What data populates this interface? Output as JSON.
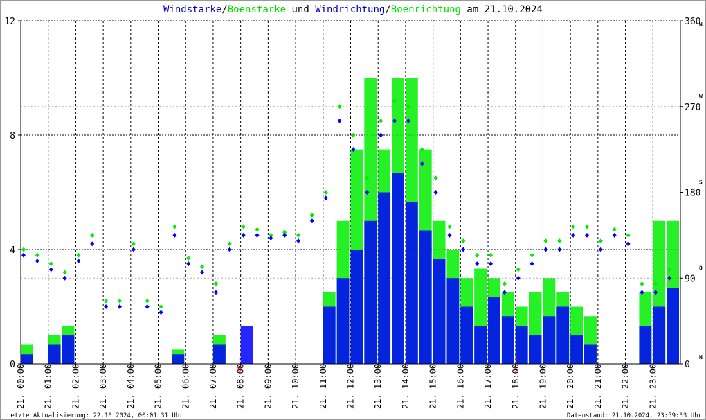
{
  "chart_data": {
    "type": "scatter",
    "title_parts": [
      {
        "text": "Windstarke",
        "color": "#0000c0"
      },
      {
        "text": "/",
        "color": "#000000"
      },
      {
        "text": "Boenstarke",
        "color": "#00e000"
      },
      {
        "text": " und ",
        "color": "#000000"
      },
      {
        "text": "Windrichtung",
        "color": "#0000c0"
      },
      {
        "text": "/",
        "color": "#000000"
      },
      {
        "text": "Boenrichtung",
        "color": "#00e000"
      },
      {
        "text": " am 21.10.2024",
        "color": "#000000"
      }
    ],
    "left_axis": {
      "ylim": [
        0,
        12
      ],
      "ticks": [
        "0",
        "4",
        "8",
        "12"
      ]
    },
    "right_axis": {
      "ylim": [
        0,
        360
      ],
      "ticks": [
        "0",
        "90",
        "180",
        "270",
        "360"
      ],
      "compass": [
        "N",
        "O",
        "S",
        "W",
        "N"
      ]
    },
    "x_ticks": [
      "21. 00:00",
      "21. 01:00",
      "21. 02:00",
      "21. 03:00",
      "21. 04:00",
      "21. 05:00",
      "21. 06:00",
      "21. 07:00",
      "21. 08:00",
      "21. 09:00",
      "21. 10:00",
      "21. 11:00",
      "21. 12:00",
      "21. 13:00",
      "21. 14:00",
      "21. 15:00",
      "21. 16:00",
      "21. 17:00",
      "21. 18:00",
      "21. 19:00",
      "21. 20:00",
      "21. 21:00",
      "21. 22:00",
      "21. 23:00"
    ],
    "grid": true,
    "x_hours": [
      0,
      0.5,
      1,
      1.5,
      2,
      2.5,
      3,
      3.5,
      4,
      4.5,
      5,
      5.5,
      6,
      6.5,
      7,
      7.5,
      8,
      8.5,
      9,
      9.5,
      10,
      10.5,
      11,
      11.5,
      12,
      12.5,
      13,
      13.5,
      14,
      14.5,
      15,
      15.5,
      16,
      16.5,
      17,
      17.5,
      18,
      18.5,
      19,
      19.5,
      20,
      20.5,
      21,
      21.5,
      22,
      22.5,
      23,
      23.5
    ],
    "series": [
      {
        "name": "Windstarke",
        "color": "#0000ff",
        "axis": "left",
        "values": [
          3.8,
          3.6,
          3.3,
          3.0,
          3.6,
          4.2,
          2.0,
          2.0,
          4.0,
          2.0,
          1.8,
          4.5,
          3.5,
          3.2,
          2.5,
          4.0,
          4.5,
          4.5,
          4.4,
          4.5,
          4.3,
          5.0,
          5.8,
          8.5,
          7.5,
          6.0,
          8.0,
          8.5,
          8.5,
          7.0,
          6.0,
          4.5,
          4.0,
          3.5,
          3.5,
          2.5,
          3.0,
          3.5,
          4.0,
          4.0,
          4.5,
          4.5,
          4.0,
          4.5,
          4.2,
          2.5,
          2.5,
          3.0
        ]
      },
      {
        "name": "Boenstarke",
        "color": "#00ee00",
        "axis": "left",
        "values": [
          4.0,
          3.8,
          3.5,
          3.2,
          3.8,
          4.5,
          2.2,
          2.2,
          4.2,
          2.2,
          2.0,
          4.8,
          3.7,
          3.4,
          2.8,
          4.2,
          4.8,
          4.7,
          4.5,
          4.6,
          4.5,
          5.2,
          6.0,
          9.0,
          8.0,
          6.5,
          8.5,
          9.2,
          9.0,
          7.5,
          6.5,
          4.8,
          4.3,
          3.8,
          3.8,
          2.8,
          3.3,
          3.8,
          4.3,
          4.3,
          4.8,
          4.8,
          4.3,
          4.7,
          4.5,
          2.8,
          2.8,
          3.3
        ]
      },
      {
        "name": "Windrichtung",
        "color": "#0000ff",
        "axis": "right",
        "values": [
          10,
          0,
          20,
          30,
          0,
          0,
          0,
          0,
          0,
          0,
          0,
          10,
          0,
          0,
          20,
          0,
          40,
          0,
          0,
          0,
          0,
          0,
          60,
          90,
          120,
          150,
          180,
          200,
          170,
          140,
          110,
          90,
          60,
          40,
          70,
          50,
          40,
          30,
          50,
          60,
          30,
          20,
          0,
          0,
          0,
          40,
          60,
          80
        ]
      },
      {
        "name": "Boenrichtung",
        "color": "#00ee00",
        "axis": "right",
        "values": [
          20,
          0,
          30,
          40,
          0,
          0,
          0,
          0,
          0,
          0,
          0,
          15,
          0,
          0,
          30,
          0,
          0,
          0,
          0,
          0,
          0,
          0,
          75,
          150,
          225,
          300,
          225,
          300,
          300,
          225,
          150,
          120,
          90,
          100,
          90,
          75,
          60,
          75,
          90,
          75,
          60,
          50,
          0,
          0,
          0,
          75,
          150,
          150
        ]
      }
    ],
    "markers": [
      {
        "label": "H",
        "hour": 7.95,
        "color": "#ff0000"
      },
      {
        "label": "U",
        "hour": 18.05,
        "color": "#ff0000"
      }
    ]
  },
  "footer": {
    "left": "Letzte Aktualisierung: 22.10.2024, 00:01:31 Uhr",
    "right": "Datenstand: 21.10.2024, 23:59:33 Uhr"
  }
}
